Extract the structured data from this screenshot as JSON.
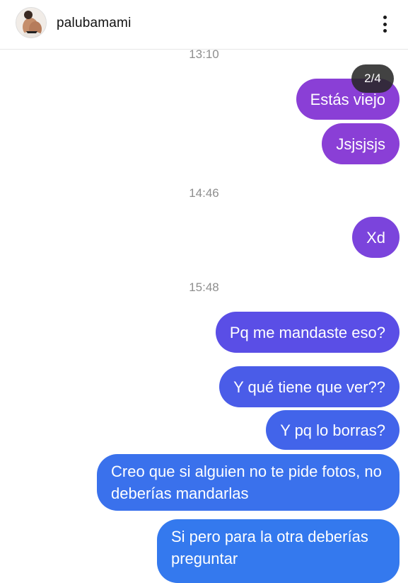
{
  "header": {
    "username": "palubamami",
    "avatar_icon": "profile-photo",
    "menu_icon": "more-vertical-icon"
  },
  "overlay": {
    "counter": "2/4"
  },
  "timestamps": [
    "13:10",
    "14:46",
    "15:48"
  ],
  "messages": [
    {
      "text": "Estás viejo",
      "color": "#8a3fd6"
    },
    {
      "text": "Jsjsjsjs",
      "color": "#8a3fd6"
    },
    {
      "text": "Xd",
      "color": "#7b44dc"
    },
    {
      "text": "Pq me mandaste eso?",
      "color": "#5a4ee6"
    },
    {
      "text": "Y qué tiene que ver??",
      "color": "#4a5ce8"
    },
    {
      "text": "Y pq lo borras?",
      "color": "#4264ea"
    },
    {
      "text": "Creo que si alguien no te pide fotos, no deberías mandarlas",
      "color": "#3a71ec"
    },
    {
      "text": "Si pero para la otra deberías preguntar",
      "color": "#3479ee"
    }
  ]
}
